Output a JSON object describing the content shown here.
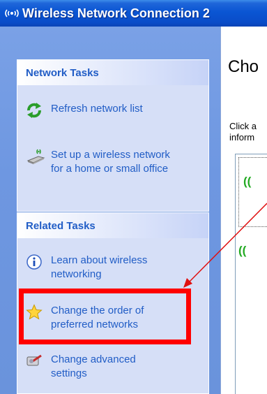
{
  "window": {
    "title": "Wireless Network Connection 2",
    "title_icon": "wireless-signal-icon"
  },
  "left_pane": {
    "network_tasks": {
      "header": "Network Tasks",
      "items": [
        {
          "label": "Refresh network list",
          "icon": "refresh-icon"
        },
        {
          "label": "Set up a wireless network\nfor a home or small office",
          "icon": "wireless-setup-icon"
        }
      ]
    },
    "related_tasks": {
      "header": "Related Tasks",
      "items": [
        {
          "label": "Learn about wireless\nnetworking",
          "icon": "info-icon"
        },
        {
          "label": "Change the order of\npreferred networks",
          "icon": "star-icon"
        },
        {
          "label": "Change advanced\nsettings",
          "icon": "settings-icon"
        }
      ]
    }
  },
  "right_pane": {
    "heading": "Cho",
    "description_line1": "Click a",
    "description_line2": "inform",
    "networks": [
      {
        "signal_icon": "wireless-signal-icon",
        "selected": true
      },
      {
        "signal_icon": "wireless-signal-icon",
        "selected": false
      }
    ]
  },
  "annotation": {
    "highlight_color": "#ff0000",
    "arrow_color": "#e01010"
  }
}
